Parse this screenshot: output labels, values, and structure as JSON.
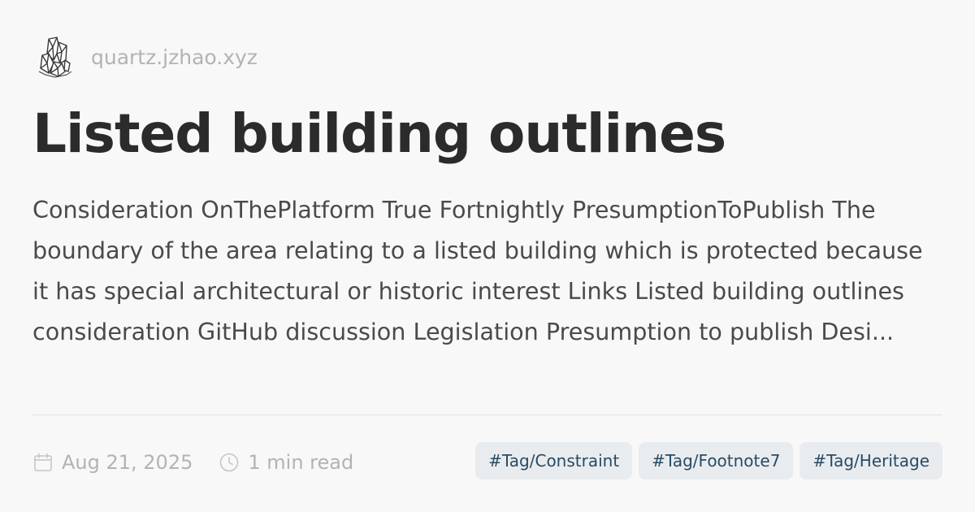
{
  "site": {
    "logo_icon": "crystal-logo-icon",
    "url": "quartz.jzhao.xyz"
  },
  "page": {
    "title": "Listed building outlines",
    "description": "Consideration OnThePlatform True Fortnightly PresumptionToPublish The boundary of the area relating to a listed building which is protected because it has special architectural or historic interest Links Listed building outlines consideration GitHub discussion Legislation Presumption to publish Desi..."
  },
  "meta": {
    "date_icon": "calendar-icon",
    "date": "Aug 21, 2025",
    "reading_icon": "clock-icon",
    "reading_time": "1 min read"
  },
  "tags": [
    "#Tag/Constraint",
    "#Tag/Footnote7",
    "#Tag/Heritage"
  ],
  "colors": {
    "background": "#f8f8f8",
    "title": "#2b2b2b",
    "description": "#4a4a4a",
    "muted": "#b3b3b3",
    "tag_background": "#e9ecef",
    "tag_text": "#284b63"
  }
}
